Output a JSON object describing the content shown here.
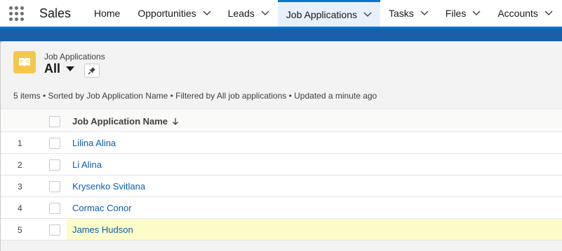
{
  "app": {
    "name": "Sales"
  },
  "nav": {
    "home": "Home",
    "tabs": [
      {
        "label": "Opportunities",
        "active": false
      },
      {
        "label": "Leads",
        "active": false
      },
      {
        "label": "Job Applications",
        "active": true
      },
      {
        "label": "Tasks",
        "active": false
      },
      {
        "label": "Files",
        "active": false
      },
      {
        "label": "Accounts",
        "active": false
      }
    ]
  },
  "header": {
    "object_name": "Job Applications",
    "list_view": "All",
    "icon": "book-icon",
    "meta": "5 items • Sorted by Job Application Name • Filtered by All job applications • Updated a minute ago"
  },
  "table": {
    "column": "Job Application Name",
    "sort_icon": "arrow-down-icon",
    "rows": [
      {
        "num": "1",
        "name": "Lilina Alina"
      },
      {
        "num": "2",
        "name": "Li Alina"
      },
      {
        "num": "3",
        "name": "Krysenko Svitlana"
      },
      {
        "num": "4",
        "name": "Cormac Conor"
      },
      {
        "num": "5",
        "name": "James Hudson"
      }
    ]
  },
  "colors": {
    "brand": "#0176d3",
    "link": "#0b5cab",
    "icon_bg": "#f4c84d",
    "highlight": "#fbfcc8"
  }
}
